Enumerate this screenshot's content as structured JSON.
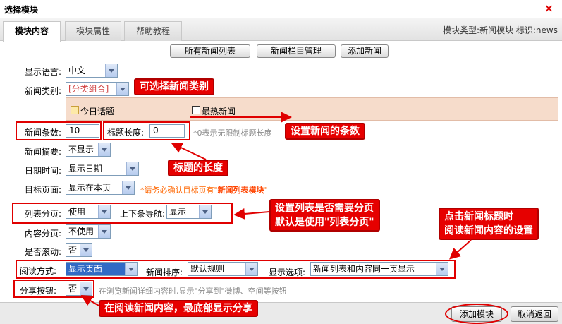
{
  "window": {
    "title": "选择模块",
    "close": "×"
  },
  "tabs": [
    {
      "label": "模块内容",
      "active": true
    },
    {
      "label": "模块属性",
      "active": false
    },
    {
      "label": "帮助教程",
      "active": false
    }
  ],
  "module_info": "模块类型:新闻模块  标识:news",
  "top_buttons": [
    "所有新闻列表",
    "新闻栏目管理",
    "添加新闻"
  ],
  "form": {
    "language": {
      "label": "显示语言:",
      "value": "中文"
    },
    "category": {
      "label": "新闻类别:",
      "value": "[分类组合]"
    },
    "checkbox_today": "今日话题",
    "checkbox_hot": "最热新闻",
    "count": {
      "label": "新闻条数:",
      "value": "10"
    },
    "title_length": {
      "label": "标题长度:",
      "value": "0"
    },
    "title_length_note": "*0表示无限制标题长度",
    "summary": {
      "label": "新闻摘要:",
      "value": "不显示"
    },
    "date": {
      "label": "日期时间:",
      "value": "显示日期"
    },
    "target": {
      "label": "目标页面:",
      "value": "显示在本页"
    },
    "target_note_prefix": "*请务必确认目标页有\"",
    "target_note_bold": "新闻列表模块",
    "target_note_suffix": "\"",
    "list_paging": {
      "label": "列表分页:",
      "value": "使用"
    },
    "prevnext": {
      "label": "上下条导航:",
      "value": "显示"
    },
    "content_paging": {
      "label": "内容分页:",
      "value": "不使用"
    },
    "scroll": {
      "label": "是否滚动:",
      "value": "否"
    },
    "read_mode": {
      "label": "阅读方式:",
      "value": "显示页面"
    },
    "sort": {
      "label": "新闻排序:",
      "value": "默认规则"
    },
    "display_option": {
      "label": "显示选项:",
      "value": "新闻列表和内容同一页显示"
    },
    "share": {
      "label": "分享按钮:",
      "value": "否"
    },
    "share_note": "在浏览新闻详细内容时,显示\"分享到\"微博、空间等按钮"
  },
  "callouts": {
    "category": "可选择新闻类别",
    "count": "设置新闻的条数",
    "title_length": "标题的长度",
    "paging_line1": "设置列表是否需要分页",
    "paging_line2": "默认是使用\"列表分页\"",
    "read_line1": "点击新闻标题时",
    "read_line2": "阅读新闻内容的设置",
    "share": "在阅读新闻内容，最底部显示分享"
  },
  "bottom_buttons": {
    "add": "添加模块",
    "cancel": "取消返回"
  },
  "colors": {
    "callout_red": "#e60000",
    "highlight_blue": "#316ac5",
    "pink_panel": "#f6dccb"
  }
}
